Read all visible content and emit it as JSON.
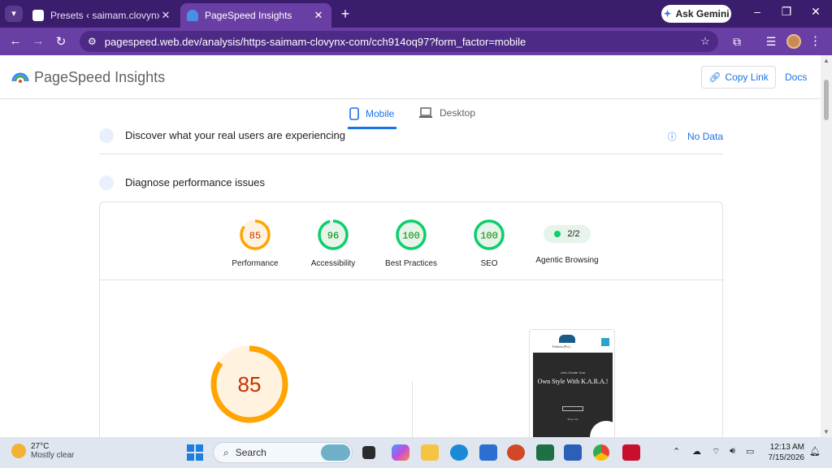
{
  "browser": {
    "tabs": [
      {
        "title": "Presets ‹ saimam.clovynx.com —",
        "active": false
      },
      {
        "title": "PageSpeed Insights",
        "active": true
      }
    ],
    "ask_gemini": "Ask Gemini",
    "url": "pagespeed.web.dev/analysis/https-saimam-clovynx-com/cch914oq97?form_factor=mobile"
  },
  "header": {
    "title": "PageSpeed Insights",
    "copy_link": "Copy Link",
    "docs": "Docs"
  },
  "device_tabs": {
    "mobile": "Mobile",
    "desktop": "Desktop"
  },
  "sections": {
    "real_users": "Discover what your real users are experiencing",
    "no_data": "No Data",
    "diagnose": "Diagnose performance issues"
  },
  "scores": [
    {
      "label": "Performance",
      "value": "85",
      "fraction": 0.85,
      "color": "#ffa400",
      "track": "#fff3e0",
      "text_color": "#c33300"
    },
    {
      "label": "Accessibility",
      "value": "96",
      "fraction": 0.96,
      "color": "#0cce6b",
      "track": "#e6f4ea",
      "text_color": "#008800"
    },
    {
      "label": "Best Practices",
      "value": "100",
      "fraction": 1.0,
      "color": "#0cce6b",
      "track": "#e6f4ea",
      "text_color": "#008800"
    },
    {
      "label": "SEO",
      "value": "100",
      "fraction": 1.0,
      "color": "#0cce6b",
      "track": "#e6f4ea",
      "text_color": "#008800"
    }
  ],
  "agentic": {
    "label": "Agentic Browsing",
    "value": "2/2"
  },
  "main_score": {
    "value": "85",
    "fraction": 0.85,
    "color": "#ffa400",
    "track": "#fff3e0",
    "text_color": "#c33300"
  },
  "preview": {
    "brand": "Fashion (Pvt)",
    "tagline": "Let's Create Your",
    "headline": "Own Style With K.A.R.A.!",
    "footer": "Shop now"
  },
  "taskbar": {
    "temp": "27°C",
    "weather": "Mostly clear",
    "search": "Search",
    "time": "12:13 AM",
    "date": "7/15/2026"
  }
}
